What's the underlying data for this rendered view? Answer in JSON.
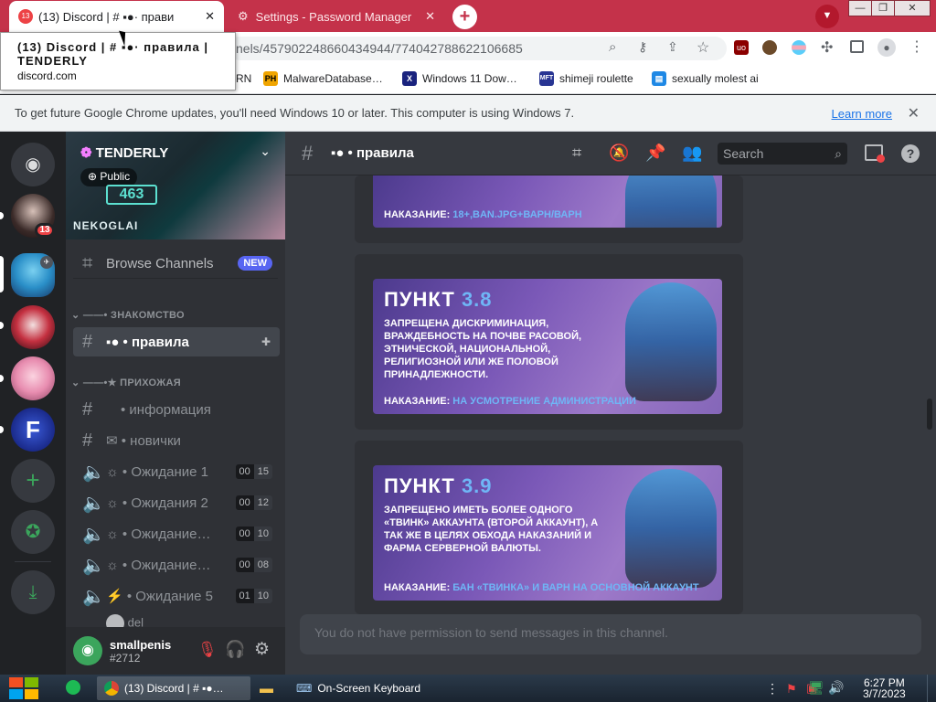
{
  "browser": {
    "tabs": [
      {
        "label": "(13) Discord | # ▪●· прави",
        "badge": "13",
        "active": true
      },
      {
        "label": "Settings - Password Manager",
        "active": false
      }
    ],
    "new_tab": "+",
    "url": "nels/457902248660434944/774042788622106685",
    "tooltip": {
      "title": "(13) Discord | # ▪●· правила | TENDERLY",
      "domain": "discord.com"
    },
    "bookmarks": [
      {
        "label": "RN",
        "icon": "bookmark-icon"
      },
      {
        "label": "MalwareDatabase…",
        "icon": "ph-icon"
      },
      {
        "label": "Windows 11 Dow…",
        "icon": "x-icon"
      },
      {
        "label": "shimeji roulette",
        "icon": "mft-icon"
      },
      {
        "label": "sexually molest ai",
        "icon": "document-icon"
      }
    ],
    "infobar": {
      "text": "To get future Google Chrome updates, you'll need Windows 10 or later. This computer is using Windows 7.",
      "link": "Learn more"
    }
  },
  "discord": {
    "server": {
      "name": "TENDERLY",
      "visibility": "Public",
      "banner_number": "463",
      "banner_tag": "NEKOGLAI"
    },
    "mention_badge": "13",
    "browse": {
      "label": "Browse Channels",
      "badge": "NEW"
    },
    "categories": [
      {
        "label": "——• ЗНАКОМСТВО"
      },
      {
        "label": "——•★ ПРИХОЖАЯ"
      }
    ],
    "channels": {
      "rules": "▪● • правила",
      "info": "• информация",
      "newbies": "✉ • новички",
      "voice": [
        {
          "label": "☼ • Ожидание 1",
          "a": "00",
          "b": "15"
        },
        {
          "label": "☼ • Ожидания 2",
          "a": "00",
          "b": "12"
        },
        {
          "label": "☼ • Ожидание…",
          "a": "00",
          "b": "10"
        },
        {
          "label": "☼ • Ожидание…",
          "a": "00",
          "b": "08"
        },
        {
          "label": "⚡ • Ожидание 5",
          "a": "01",
          "b": "10"
        }
      ],
      "partial": "del"
    },
    "header": {
      "channel": "▪● • правила",
      "search_placeholder": "Search"
    },
    "rules": [
      {
        "punishment_label": "НАКАЗАНИЕ:",
        "punishment": "18+,BAN.JPG+ВАРН/ВАРН"
      },
      {
        "title_word": "ПУНКТ",
        "number": "3.8",
        "body": "ЗАПРЕЩЕНА ДИСКРИМИНАЦИЯ, ВРАЖДЕБНОСТЬ НА ПОЧВЕ РАСОВОЙ, ЭТНИЧЕСКОЙ, НАЦИОНАЛЬНОЙ, РЕЛИГИОЗНОЙ ИЛИ ЖЕ ПОЛОВОЙ ПРИНАДЛЕЖНОСТИ.",
        "punishment_label": "НАКАЗАНИЕ:",
        "punishment": "НА УСМОТРЕНИЕ АДМИНИСТРАЦИИ"
      },
      {
        "title_word": "ПУНКТ",
        "number": "3.9",
        "body": "ЗАПРЕЩЕНО ИМЕТЬ БОЛЕЕ ОДНОГО «ТВИНК» АККАУНТА (ВТОРОЙ АККАУНТ), А ТАК ЖЕ В ЦЕЛЯХ ОБХОДА НАКАЗАНИЙ И ФАРМА СЕРВЕРНОЙ ВАЛЮТЫ.",
        "punishment_label": "НАКАЗАНИЕ:",
        "punishment": "БАН «ТВИНКА» И ВАРН НА ОСНОВНОЙ АККАУНТ"
      }
    ],
    "no_permission": "You do not have permission to send messages in this channel.",
    "user": {
      "name": "smallpenis",
      "tag": "#2712"
    },
    "colors": {
      "accent_blue": "#6fb6f6",
      "mention_red": "#ed4245",
      "new_badge": "#5865f2"
    }
  },
  "taskbar": {
    "items": [
      {
        "label": "(13) Discord | # ▪●…",
        "icon": "chrome-icon"
      },
      {
        "label": "",
        "icon": "folder-icon"
      },
      {
        "label": "On-Screen Keyboard",
        "icon": "keyboard-icon"
      }
    ],
    "time": "6:27 PM",
    "date": "3/7/2023"
  }
}
